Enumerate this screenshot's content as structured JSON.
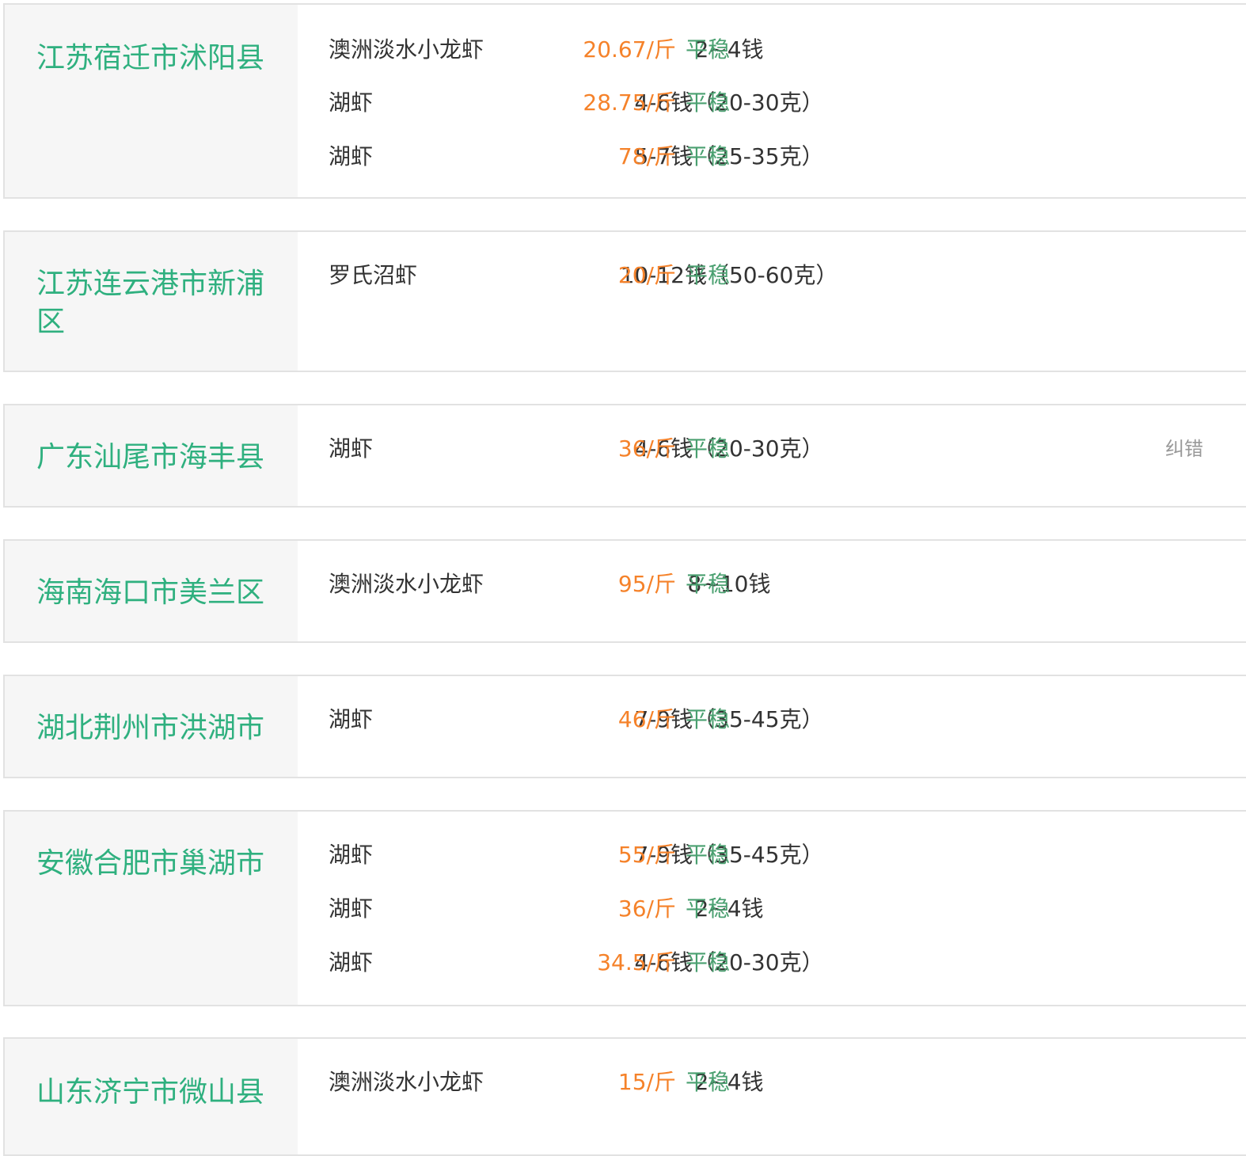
{
  "rows": [
    {
      "location": "江苏宿迁市沭阳县",
      "items": [
        {
          "type": "澳洲淡水小龙虾",
          "spec": "2~4钱",
          "price": "20.67/斤",
          "trend": "平稳"
        },
        {
          "type": "湖虾",
          "spec": "4-6钱（20-30克）",
          "price": "28.75/斤",
          "trend": "平稳"
        },
        {
          "type": "湖虾",
          "spec": "5-7钱（25-35克）",
          "price": "78/斤",
          "trend": "平稳"
        }
      ]
    },
    {
      "location": "江苏连云港市新浦区",
      "items": [
        {
          "type": "罗氏沼虾",
          "spec": "10-12钱（50-60克）",
          "price": "20/斤",
          "trend": "平稳"
        }
      ]
    },
    {
      "location": "广东汕尾市海丰县",
      "items": [
        {
          "type": "湖虾",
          "spec": "4-6钱（20-30克）",
          "price": "36/斤",
          "trend": "平稳",
          "report": "纠错"
        }
      ]
    },
    {
      "location": "海南海口市美兰区",
      "items": [
        {
          "type": "澳洲淡水小龙虾",
          "spec": "8~10钱",
          "price": "95/斤",
          "trend": "平稳"
        }
      ]
    },
    {
      "location": "湖北荆州市洪湖市",
      "items": [
        {
          "type": "湖虾",
          "spec": "7-9钱（35-45克）",
          "price": "46/斤",
          "trend": "平稳"
        }
      ]
    },
    {
      "location": "安徽合肥市巢湖市",
      "items": [
        {
          "type": "湖虾",
          "spec": "7-9钱（35-45克）",
          "price": "55/斤",
          "trend": "平稳"
        },
        {
          "type": "湖虾",
          "spec": "2~4钱",
          "price": "36/斤",
          "trend": "平稳"
        },
        {
          "type": "湖虾",
          "spec": "4-6钱（20-30克）",
          "price": "34.5/斤",
          "trend": "平稳"
        }
      ]
    },
    {
      "location": "山东济宁市微山县",
      "items": [
        {
          "type": "澳洲淡水小龙虾",
          "spec": "2~4钱",
          "price": "15/斤",
          "trend": "平稳"
        }
      ]
    }
  ],
  "colors": {
    "location": "#2fb07f",
    "price": "#f5822a",
    "trend": "#4aa070",
    "text": "#333333",
    "muted": "#999999",
    "border": "#e2e2e2",
    "location_bg": "#f6f6f6"
  }
}
